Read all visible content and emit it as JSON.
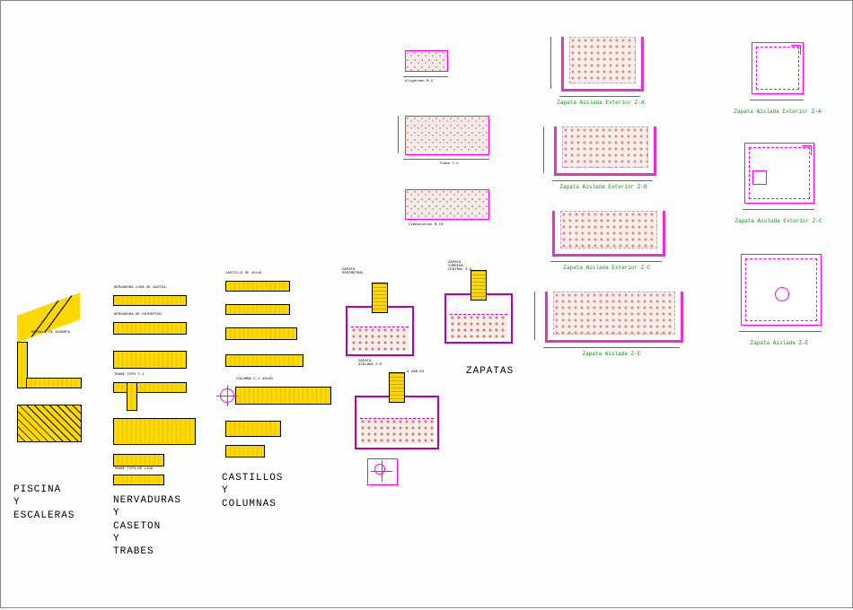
{
  "sections": {
    "piscina": "PISCINA\nY\nESCALERAS",
    "nervaduras": "NERVADURAS\nY\nCASETON\nY\nTRABES",
    "castillos": "CASTILLOS\nY\nCOLUMNAS",
    "zapatas": "ZAPATAS"
  },
  "footings": {
    "ext_a": "Zapata Aislada Exterior Z-A",
    "ext_b": "Zapata Aislada Exterior Z-B",
    "ext_c": "Zapata Aislada Exterior Z-C",
    "z_e": "Zapata Aislada Z-E",
    "plan_a": "Zapata Aislada Exterior Z-A",
    "plan_c": "Zapata Aislada Exterior Z-C",
    "plan_e": "Zapata Aislada Z-E"
  },
  "small": {
    "aligerado": "Aligerado B-2",
    "trabe": "Trabe T-2",
    "cimentacion": "Cimentación B-10",
    "zapata_perimetral": "ZAPATA\nPERIMETRAL",
    "zapata_corrida": "ZAPATA\nCORRIDA\nCENTRAL Z-A",
    "zapata_aislada": "ZAPATA\nAISLADA Z-D",
    "rebar": "4 VAR.#3",
    "columna": "COLUMNA C-1 40x40"
  },
  "colors": {
    "magenta": "#e92fd4",
    "green": "#00a000",
    "yellow": "#ffd800"
  }
}
